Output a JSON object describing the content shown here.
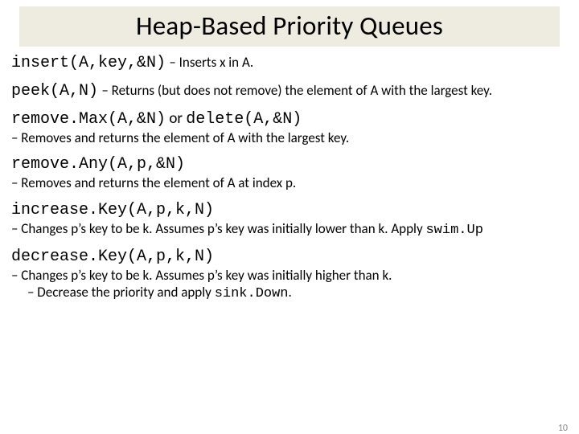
{
  "title": "Heap-Based Priority Queues",
  "items": {
    "insert": {
      "sig": "insert(A,key,&N)",
      "desc": "– Inserts x in A."
    },
    "peek": {
      "sig": "peek(A,N)",
      "desc": "– Returns (but does not remove) the element of A with the largest key."
    },
    "removeMax": {
      "sig1": "remove.Max(A,&N)",
      "mid": " or ",
      "sig2": "delete(A,&N)",
      "desc": "– Removes and returns the element of A with the largest key."
    },
    "removeAny": {
      "sig": "remove.Any(A,p,&N)",
      "desc": "– Removes and returns the element of A at index p."
    },
    "increaseKey": {
      "sig": "increase.Key(A,p,k,N)",
      "desc_pre": "– Changes p’s key to be k. Assumes p’s key was initially lower than k. Apply ",
      "desc_code": "swim.Up"
    },
    "decreaseKey": {
      "sig": "decrease.Key(A,p,k,N)",
      "desc": "– Changes p’s key to be k. Assumes p’s key was initially higher than k.",
      "sub_pre": "–   Decrease the priority and apply ",
      "sub_code": "sink.Down",
      "sub_post": "."
    }
  },
  "slide_number": "10"
}
